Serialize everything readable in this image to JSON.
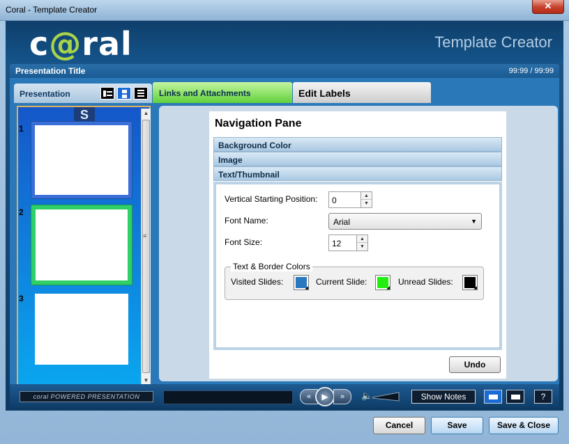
{
  "window": {
    "title": "Coral - Template Creator",
    "close_label": "✕"
  },
  "header": {
    "logo": "coral",
    "app_name": "Template Creator"
  },
  "presentation_bar": {
    "title": "Presentation Title",
    "counter": "99:99 / 99:99"
  },
  "tabs": {
    "presentation": "Presentation",
    "links": "Links and Attachments",
    "edit_labels": "Edit Labels"
  },
  "slides": {
    "badge": "S",
    "items": [
      {
        "number": "1",
        "state": "default"
      },
      {
        "number": "2",
        "state": "current"
      },
      {
        "number": "3",
        "state": "default"
      }
    ]
  },
  "nav_pane": {
    "title": "Navigation Pane",
    "sections": [
      "Background Color",
      "Image",
      "Text/Thumbnail"
    ],
    "vertical_start": {
      "label": "Vertical Starting Position:",
      "value": "0"
    },
    "font_name": {
      "label": "Font Name:",
      "value": "Arial"
    },
    "font_size": {
      "label": "Font Size:",
      "value": "12"
    },
    "colors_group": {
      "legend": "Text & Border Colors",
      "visited": {
        "label": "Visited Slides:",
        "color": "#2a78c0"
      },
      "current": {
        "label": "Current Slide:",
        "color": "#22ee10"
      },
      "unread": {
        "label": "Unread Slides:",
        "color": "#000000"
      }
    },
    "undo_label": "Undo"
  },
  "player": {
    "powered_label": "coral POWERED PRESENTATION",
    "rewind": "«",
    "play": "▶",
    "forward": "»",
    "show_notes": "Show Notes",
    "help": "?"
  },
  "footer": {
    "cancel": "Cancel",
    "save": "Save",
    "save_close": "Save & Close"
  }
}
